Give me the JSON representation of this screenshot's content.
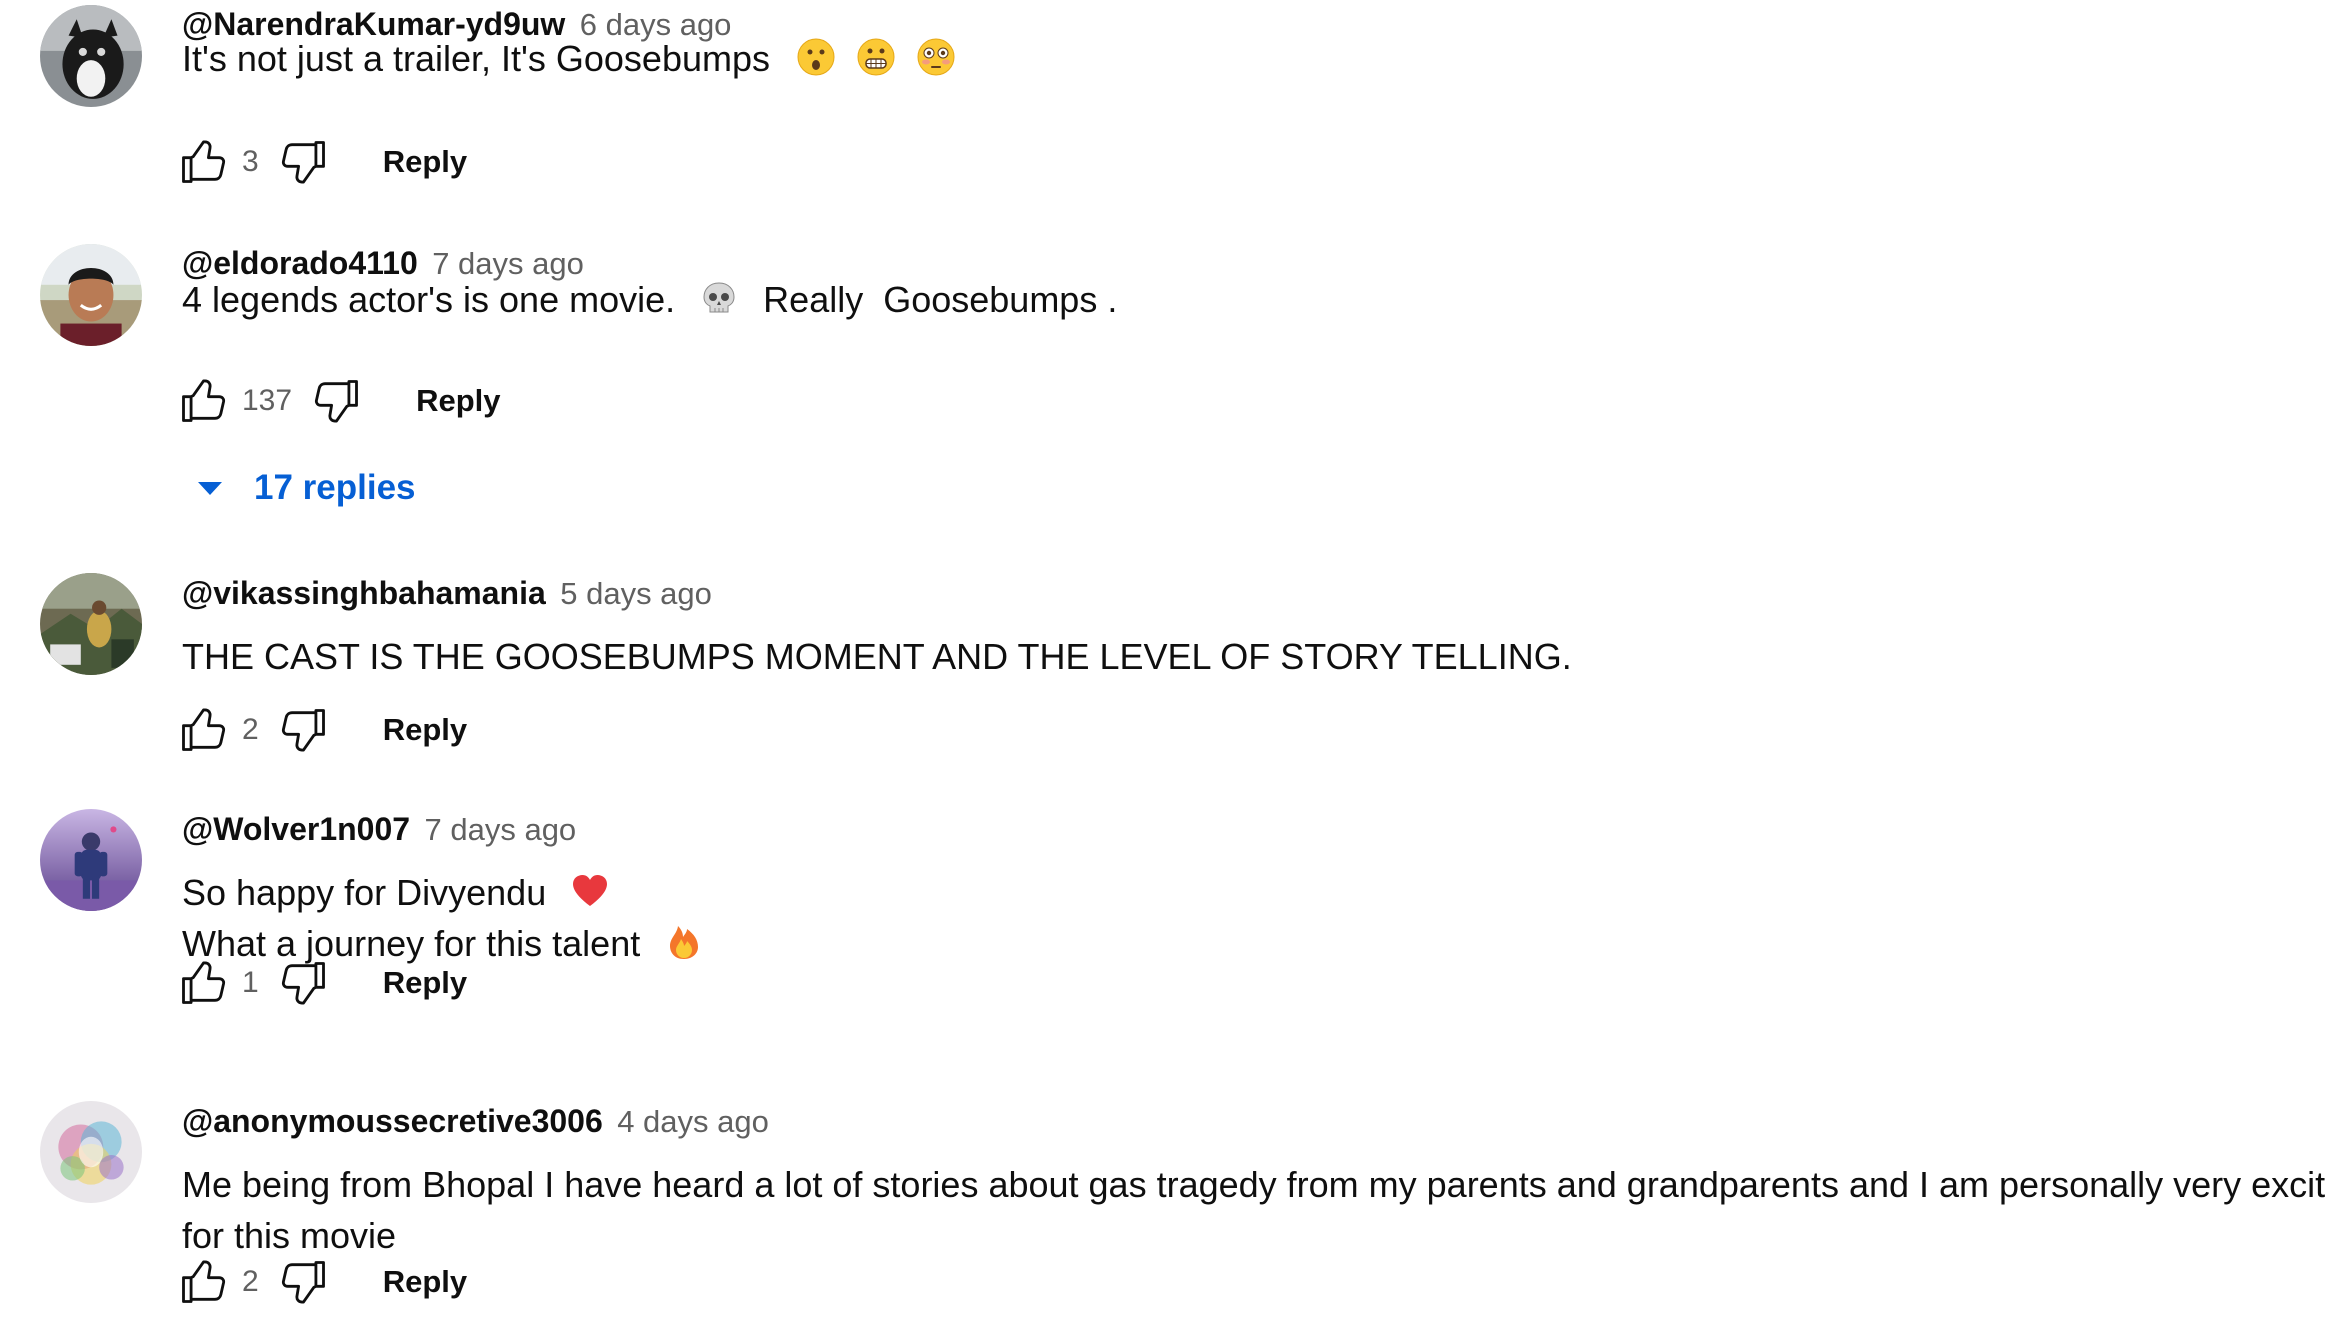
{
  "comments": [
    {
      "author": "@NarendraKumar-yd9uw",
      "time": "6 days ago",
      "text_lines": [
        "It's not just a trailer, It's Goosebumps"
      ],
      "emojis": [
        "hushed-face-emoji",
        "grimacing-face-emoji",
        "flushed-face-emoji"
      ],
      "likes": "3",
      "reply_label": "Reply"
    },
    {
      "author": "@eldorado4110",
      "time": "7 days ago",
      "text_before": "4 legends actor's is one movie.",
      "text_after": "Really  Goosebumps .",
      "emojis": [
        "skull-emoji"
      ],
      "likes": "137",
      "reply_label": "Reply",
      "replies_label": "17 replies"
    },
    {
      "author": "@vikassinghbahamania",
      "time": "5 days ago",
      "text_lines": [
        "THE CAST IS THE GOOSEBUMPS MOMENT AND THE LEVEL OF STORY TELLING."
      ],
      "likes": "2",
      "reply_label": "Reply"
    },
    {
      "author": "@Wolver1n007",
      "time": "7 days ago",
      "text_lines": [
        "So happy for Divyendu",
        "What a journey for this talent"
      ],
      "emojis": [
        "red-heart-emoji",
        "fire-emoji"
      ],
      "likes": "1",
      "reply_label": "Reply"
    },
    {
      "author": "@anonymoussecretive3006",
      "time": "4 days ago",
      "text_lines": [
        "Me being from Bhopal I have heard a lot of stories about gas tragedy from my parents and grandparents and I am personally very excited",
        "for this movie"
      ],
      "likes": "2",
      "reply_label": "Reply"
    }
  ],
  "colors": {
    "text": "#0f0f0f",
    "secondary": "#606060",
    "link": "#065fd4"
  }
}
